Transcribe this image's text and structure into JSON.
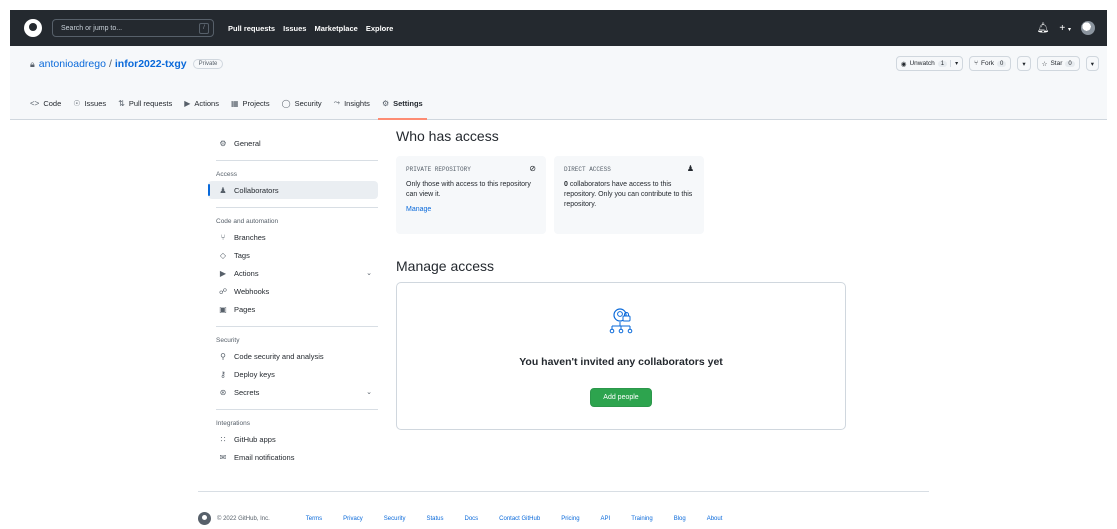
{
  "header": {
    "search_placeholder": "Search or jump to...",
    "search_shortcut": "/",
    "nav": [
      "Pull requests",
      "Issues",
      "Marketplace",
      "Explore"
    ]
  },
  "repo": {
    "owner": "antonioadrego",
    "separator": "/",
    "name": "infor2022-txgy",
    "visibility": "Private",
    "unwatch_label": "Unwatch",
    "unwatch_count": "1",
    "fork_label": "Fork",
    "fork_count": "0",
    "star_label": "Star",
    "star_count": "0"
  },
  "tabs": [
    {
      "label": "Code",
      "icon": "code-icon"
    },
    {
      "label": "Issues",
      "icon": "issue-icon"
    },
    {
      "label": "Pull requests",
      "icon": "pull-request-icon"
    },
    {
      "label": "Actions",
      "icon": "play-icon"
    },
    {
      "label": "Projects",
      "icon": "table-icon"
    },
    {
      "label": "Security",
      "icon": "shield-icon"
    },
    {
      "label": "Insights",
      "icon": "graph-icon"
    },
    {
      "label": "Settings",
      "icon": "gear-icon"
    }
  ],
  "sidebar": {
    "general": "General",
    "access_heading": "Access",
    "collaborators": "Collaborators",
    "code_heading": "Code and automation",
    "branches": "Branches",
    "tags": "Tags",
    "actions": "Actions",
    "webhooks": "Webhooks",
    "pages": "Pages",
    "security_heading": "Security",
    "code_security": "Code security and analysis",
    "deploy_keys": "Deploy keys",
    "secrets": "Secrets",
    "integrations_heading": "Integrations",
    "github_apps": "GitHub apps",
    "email_notifications": "Email notifications"
  },
  "main": {
    "who_title": "Who has access",
    "private_card": {
      "title": "PRIVATE REPOSITORY",
      "text": "Only those with access to this repository can view it.",
      "link": "Manage"
    },
    "direct_card": {
      "title": "DIRECT ACCESS",
      "count": "0",
      "text": "collaborators have access to this repository. Only you can contribute to this repository."
    },
    "manage_title": "Manage access",
    "empty_title": "You haven't invited any collaborators yet",
    "add_button": "Add people"
  },
  "footer": {
    "copyright": "© 2022 GitHub, Inc.",
    "links": [
      "Terms",
      "Privacy",
      "Security",
      "Status",
      "Docs",
      "Contact GitHub",
      "Pricing",
      "API",
      "Training",
      "Blog",
      "About"
    ]
  },
  "colors": {
    "header_bg": "#24292f",
    "link": "#0969da",
    "primary_button": "#2da44e",
    "active_tab_underline": "#fd8c73"
  }
}
